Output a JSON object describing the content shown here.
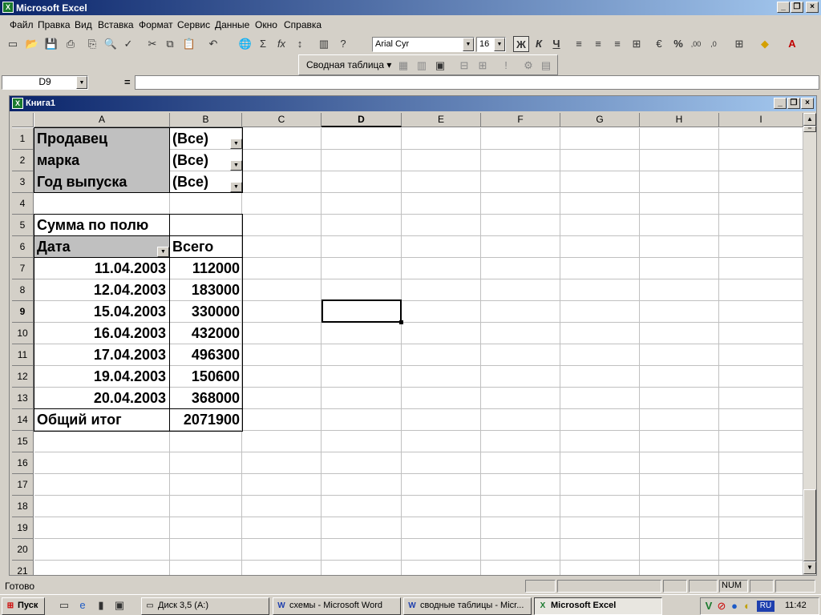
{
  "app": {
    "title": "Microsoft Excel"
  },
  "menu": [
    "Файл",
    "Правка",
    "Вид",
    "Вставка",
    "Формат",
    "Сервис",
    "Данные",
    "Окно",
    "Справка"
  ],
  "toolbar": {
    "font_name": "Arial Cyr",
    "font_size": "16",
    "bold": "Ж",
    "italic": "К",
    "underline": "Ч",
    "percent": "%"
  },
  "pivot_toolbar": {
    "label": "Сводная таблица ▾"
  },
  "formula_bar": {
    "name_box": "D9",
    "equals": "=",
    "content": ""
  },
  "workbook": {
    "title": "Книга1"
  },
  "columns": [
    "A",
    "B",
    "C",
    "D",
    "E",
    "F",
    "G",
    "H",
    "I"
  ],
  "selected_column": "D",
  "selected_row": "9",
  "rows": [
    "1",
    "2",
    "3",
    "4",
    "5",
    "6",
    "7",
    "8",
    "9",
    "10",
    "11",
    "12",
    "13",
    "14",
    "15",
    "16",
    "17",
    "18",
    "19",
    "20",
    "21"
  ],
  "pivot": {
    "page_fields": [
      {
        "label": "Продавец",
        "value": "(Все)"
      },
      {
        "label": "марка",
        "value": "(Все)"
      },
      {
        "label": "Год выпуска",
        "value": "(Все)"
      }
    ],
    "data_field": "Сумма по полю",
    "row_field": "Дата",
    "total_header": "Всего",
    "data": [
      {
        "date": "11.04.2003",
        "value": "112000"
      },
      {
        "date": "12.04.2003",
        "value": "183000"
      },
      {
        "date": "15.04.2003",
        "value": "330000"
      },
      {
        "date": "16.04.2003",
        "value": "432000"
      },
      {
        "date": "17.04.2003",
        "value": "496300"
      },
      {
        "date": "19.04.2003",
        "value": "150600"
      },
      {
        "date": "20.04.2003",
        "value": "368000"
      }
    ],
    "grand_total_label": "Общий итог",
    "grand_total_value": "2071900"
  },
  "status": {
    "text": "Готово",
    "num": "NUM"
  },
  "taskbar": {
    "start": "Пуск",
    "items": [
      "Диск 3,5 (A:)",
      "схемы - Microsoft Word",
      "сводные таблицы - Micr...",
      "Microsoft Excel"
    ],
    "lang": "RU",
    "clock": "11:42"
  }
}
